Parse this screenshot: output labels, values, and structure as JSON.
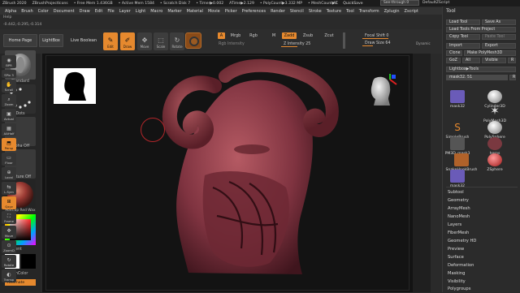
{
  "titlebar": {
    "items": [
      "ZBrush 2020",
      "ZBrushProjectIcons",
      "• Free Mem 1.436GB",
      "• Active Mem 1584",
      "• Scratch Disk 7",
      "• Timer▶0.002",
      "ATime▶2.129",
      "• PolyCount▶3.332 MP",
      "• MeshCount▶1"
    ],
    "right": [
      "AC",
      "QuickSave"
    ],
    "see_through": "See-through 0",
    "script": "DefaultZScript"
  },
  "menu": {
    "items": [
      "Alpha",
      "Brush",
      "Color",
      "Document",
      "Draw",
      "Edit",
      "File",
      "Layer",
      "Light",
      "Macro",
      "Marker",
      "Material",
      "Movie",
      "Picker",
      "Preferences",
      "Render",
      "Stencil",
      "Stroke",
      "Texture",
      "Tool",
      "Transform",
      "Zplugin",
      "Zscript"
    ],
    "hint": "Help",
    "coords": "-0.442,-0.295,-0.314"
  },
  "toolbar": {
    "home_page": "Home Page",
    "lightbox": "LightBox",
    "live_boolean": "Live Boolean",
    "edit": "Edit",
    "draw": "Draw",
    "move": "Move",
    "scale": "Scale",
    "rotate": "Rotate",
    "a_label": "A",
    "mrgb": "Mrgb",
    "rgb": "Rgb",
    "m": "M",
    "zadd": "Zadd",
    "zsub": "Zsub",
    "zcut": "Zcut",
    "rgb_intensity": "Rgb Intensity",
    "z_intensity": "Z Intensity 25",
    "focal_shift": "Focal Shift 0",
    "draw_size": "Draw Size 64",
    "dynamic": "Dynamic"
  },
  "leftpanel": {
    "brush": "Standard",
    "stroke": "Dots",
    "alpha": "Alpha Off",
    "texture": "Texture Off",
    "material": "MatCap Red Wax",
    "gradient": "Gradient",
    "switch_color": "SwitchColor",
    "alternate": "Alternate"
  },
  "vtoolbar": {
    "items": [
      "BPR",
      "SPix 3",
      "Scroll",
      "Zoom",
      "Actual",
      "AAHalf",
      "Persp",
      "Floor",
      "Local",
      "L.Sym",
      "Qxyz",
      "Frame",
      "Move",
      "ZoomD",
      "Rotate",
      "Transp"
    ]
  },
  "tool_panel": {
    "title": "Tool",
    "load_tool": "Load Tool",
    "save_as": "Save As",
    "load_tools_from_project": "Load Tools From Project",
    "copy_tool": "Copy Tool",
    "paste_tool": "Paste Tool",
    "import": "Import",
    "export": "Export",
    "clone": "Clone",
    "make_polymesh3d": "Make PolyMesh3D",
    "goz": "GoZ",
    "all": "All",
    "visible": "Visible",
    "r": "R",
    "lightbox_tools": "Lightbox▶Tools",
    "current_tool": "mask32. 51",
    "tools": [
      "mask32",
      "Cylinder3D",
      "PolyMesh3D",
      "SimpleBrush",
      "PolySphere",
      "PM3D_mask3",
      "horns",
      "SnakeHookBrush",
      "ZSphere",
      "mask32"
    ],
    "sections": [
      "Subtool",
      "Geometry",
      "ArrayMesh",
      "NanoMesh",
      "Layers",
      "FiberMesh",
      "Geometry HD",
      "Preview",
      "Surface",
      "Deformation",
      "Masking",
      "Visibility",
      "Polygroups"
    ]
  },
  "colors": {
    "accent": "#e6892e",
    "sculpt": "#8c3d46",
    "panel": "#2b2b2b"
  }
}
